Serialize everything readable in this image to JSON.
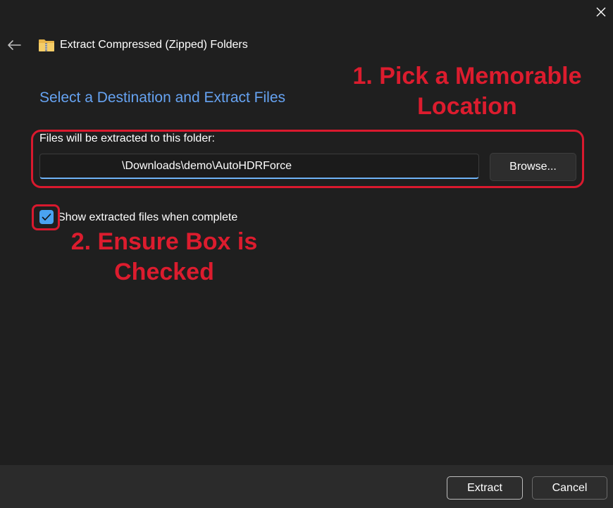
{
  "window": {
    "title": "Extract Compressed (Zipped) Folders",
    "close_icon": "close-icon",
    "back_icon": "back-arrow-icon",
    "title_icon": "zipped-folder-icon"
  },
  "main": {
    "heading": "Select a Destination and Extract Files",
    "path_label": "Files will be extracted to this folder:",
    "path_value": "\\Downloads\\demo\\AutoHDRForce",
    "browse_label": "Browse...",
    "show_files_checked": true,
    "show_files_label": "Show extracted files when complete"
  },
  "annotations": {
    "step1_line1": "1. Pick a Memorable",
    "step1_line2": "Location",
    "step2_line1": "2. Ensure Box is",
    "step2_line2": "Checked",
    "color": "#dc1c2e"
  },
  "footer": {
    "extract_label": "Extract",
    "cancel_label": "Cancel"
  },
  "colors": {
    "background": "#1f1f1f",
    "footer": "#2b2b2b",
    "accent": "#66a3f2",
    "checkbox": "#4aa3f0"
  }
}
